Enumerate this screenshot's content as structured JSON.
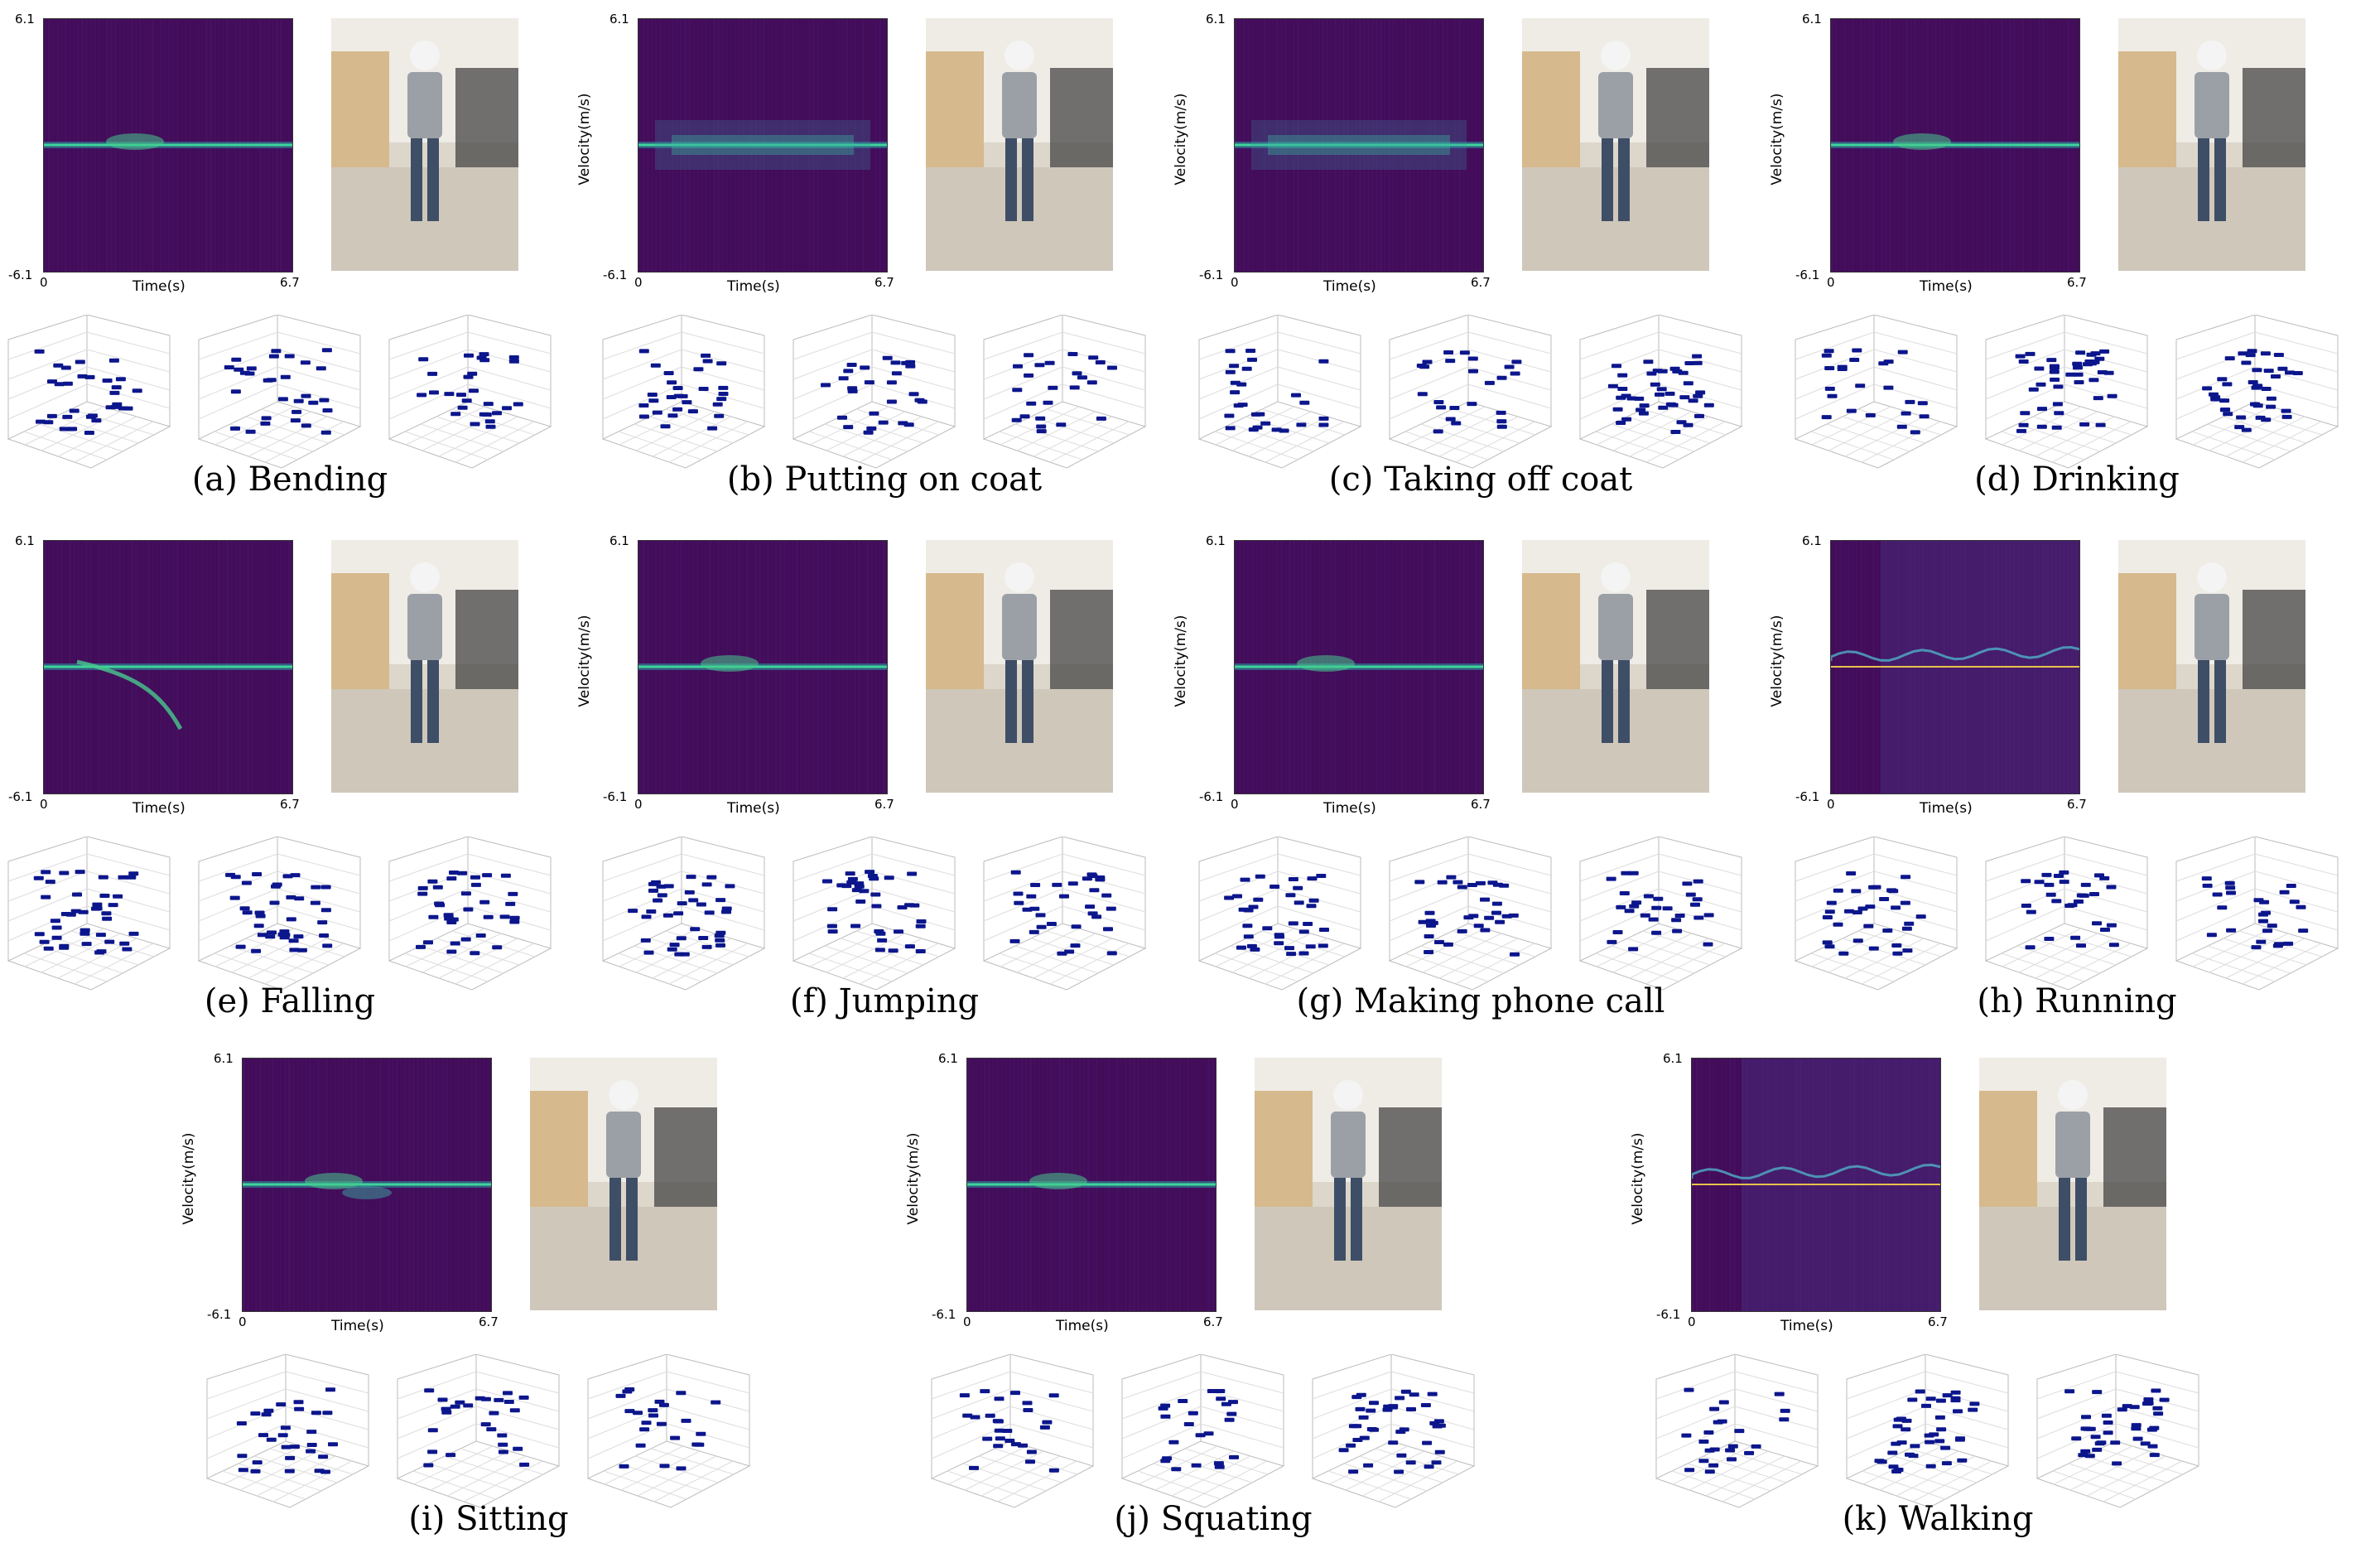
{
  "figure": {
    "colors": {
      "spec_background": "#420c59",
      "spec_line": "#3fd49a",
      "point_color": "#0c168c",
      "grid_color": "#bbbbbb"
    },
    "axes": {
      "ylabel": "Velocity(m/s)",
      "xlabel": "Time(s)",
      "y_top": "6.1",
      "y_bottom": "-6.1",
      "x_start": "0",
      "x_end": "6.7"
    },
    "panels": [
      {
        "caption": "(a) Bending"
      },
      {
        "caption": "(b) Putting on coat"
      },
      {
        "caption": "(c) Taking off coat"
      },
      {
        "caption": "(d) Drinking"
      },
      {
        "caption": "(e) Falling"
      },
      {
        "caption": "(f) Jumping"
      },
      {
        "caption": "(g) Making phone call"
      },
      {
        "caption": "(h) Running"
      },
      {
        "caption": "(i) Sitting"
      },
      {
        "caption": "(j) Squating"
      },
      {
        "caption": "(k) Walking"
      }
    ]
  }
}
